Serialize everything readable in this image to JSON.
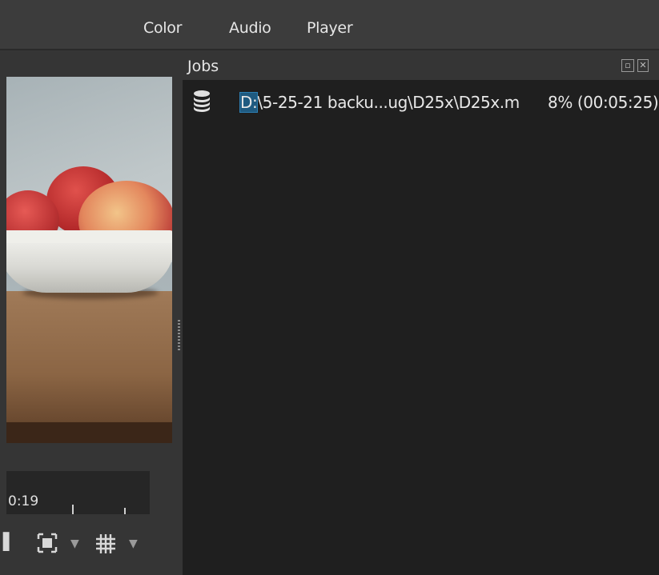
{
  "toolbar": {
    "items": [
      {
        "label": "Color"
      },
      {
        "label": "Audio"
      },
      {
        "label": "Player"
      }
    ]
  },
  "player": {
    "timecode": "0:19"
  },
  "jobs": {
    "title": "Jobs",
    "rows": [
      {
        "drive": "D:",
        "path_rest": "\\5-25-21 backu...ug\\D25x\\D25x.m",
        "status": "8% (00:05:25)"
      }
    ]
  }
}
